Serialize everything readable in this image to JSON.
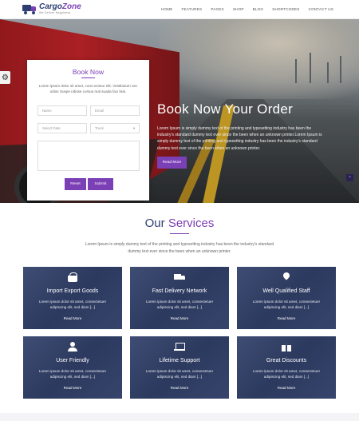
{
  "brand": {
    "name_a": "Cargo",
    "name_b": "Zone",
    "tagline": "We Deliver Happiness"
  },
  "nav": [
    "HOME",
    "FEATURES",
    "PAGES",
    "SHOP",
    "BLOG",
    "SHORTCODES",
    "CONTACT US"
  ],
  "booking": {
    "title": "Book Now",
    "description": "Lorem ipsum dolor sit amet, cons ectetur elit. Vestibulum nec odios Suspe ndisse cursus mal suada faci lisis.",
    "name_placeholder": "Name",
    "email_placeholder": "Email",
    "date_placeholder": "Select Date",
    "type_value": "Truck",
    "reset_label": "Reset",
    "submit_label": "Submit"
  },
  "hero": {
    "title": "Book Now Your Order",
    "text": "Lorem Ipsum is simply dummy text of the printing and typesetting industry has been the industry's standard dummy text ever since the been when an unknown printer.Lorem Ipsum is simply dummy text of the printing and typesetting industry has been the industry's standard dummy text ever since the been when an unknown printer.",
    "button_label": "Read More",
    "mini_button": "^"
  },
  "services": {
    "title_a": "Our",
    "title_b": "Services",
    "description": "Lorem Ipsum is simply dummy text of the printing and typesetting industry has been the industry's standard dummy text ever since the been when an unknown printer.",
    "cards": [
      {
        "title": "Import Export Goods",
        "text": "Lorem ipsum dolor sit amet, consectetuer adipiscing elit, sed diam [...]",
        "link": "Read More",
        "icon": "basket-icon"
      },
      {
        "title": "Fast Delivery Network",
        "text": "Lorem ipsum dolor sit amet, consectetuer adipiscing elit, sed diam [...]",
        "link": "Read More",
        "icon": "truck-icon"
      },
      {
        "title": "Well Qualified Staff",
        "text": "Lorem ipsum dolor sit amet, consectetuer adipiscing elit, sed diam [...]",
        "link": "Read More",
        "icon": "map-pin-icon"
      },
      {
        "title": "User Friendly",
        "text": "Lorem ipsum dolor sit amet, consectetuer adipiscing elit, sed diam [...]",
        "link": "Read More",
        "icon": "user-icon"
      },
      {
        "title": "Lifetime Support",
        "text": "Lorem ipsum dolor sit amet, consectetuer adipiscing elit, sed diam [...]",
        "link": "Read More",
        "icon": "laptop-icon"
      },
      {
        "title": "Great Discounts",
        "text": "Lorem ipsum dolor sit amet, consectetuer adipiscing elit, sed diam [...]",
        "link": "Read More",
        "icon": "gift-icon"
      }
    ]
  },
  "colors": {
    "accent": "#7b3fb6",
    "brand_dark": "#2d3e73",
    "card_overlay": "#2e3a58"
  }
}
